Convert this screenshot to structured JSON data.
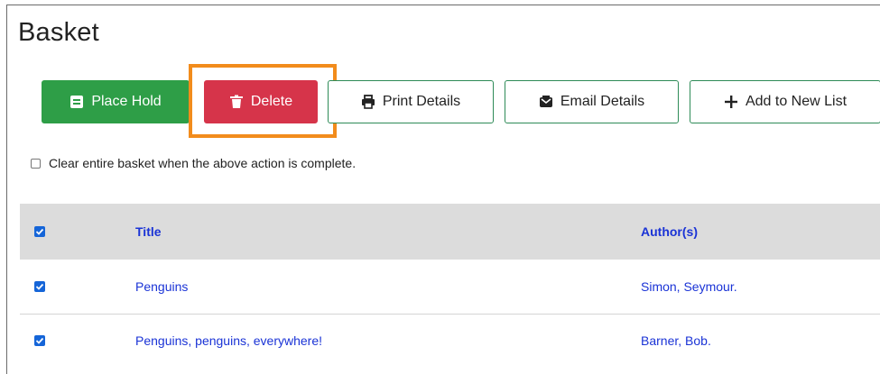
{
  "page": {
    "title": "Basket"
  },
  "toolbar": {
    "place_hold": "Place Hold",
    "delete": "Delete",
    "print_details": "Print Details",
    "email_details": "Email Details",
    "add_to_new_list": "Add to New List"
  },
  "options": {
    "clear_basket_label": "Clear entire basket when the above action is complete.",
    "clear_basket_checked": false
  },
  "table": {
    "headers": {
      "title": "Title",
      "authors": "Author(s)"
    },
    "select_all_checked": true,
    "rows": [
      {
        "title": "Penguins",
        "author": "Simon, Seymour.",
        "checked": true
      },
      {
        "title": "Penguins, penguins, everywhere!",
        "author": "Barner, Bob.",
        "checked": true
      }
    ]
  },
  "colors": {
    "place_hold_bg": "#2e9e47",
    "delete_bg": "#d6344a",
    "highlight": "#f28c1c",
    "link": "#1a33d6",
    "checkbox": "#1565d8"
  },
  "icons": {
    "place_hold": "bookmark-icon",
    "delete": "trash-icon",
    "print": "printer-icon",
    "email": "envelope-icon",
    "add": "plus-icon"
  }
}
